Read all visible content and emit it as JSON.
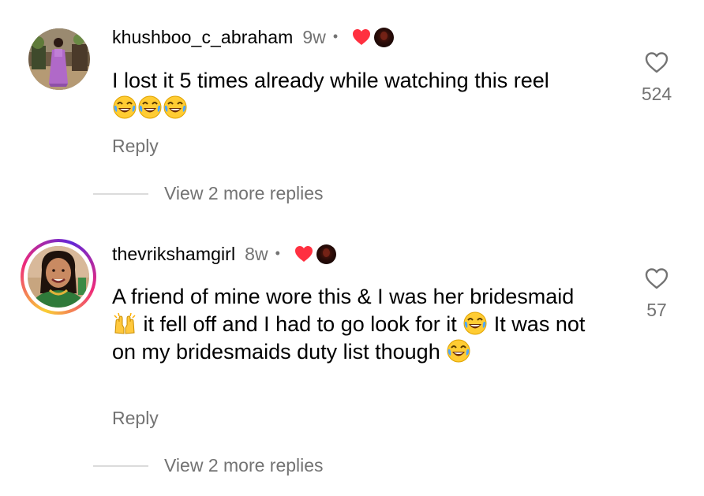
{
  "colors": {
    "text_primary": "#000000",
    "text_secondary": "#737373",
    "divider": "#dbdbdb",
    "heart_red": "#ff3040",
    "story_ring": [
      "#f9ce34",
      "#ee2a7b",
      "#6228d7"
    ]
  },
  "comments": [
    {
      "username": "khushboo_c_abraham",
      "time": "9w",
      "separator": "•",
      "creator_liked_icon": "heart-icon",
      "text_main": "I lost it 5 times already while watching this reel",
      "emojis": [
        "joy-emoji",
        "joy-emoji",
        "joy-emoji"
      ],
      "reply_label": "Reply",
      "view_replies_label": "View 2 more replies",
      "like_count": "524",
      "has_story_ring": false
    },
    {
      "username": "thevrikshamgirl",
      "time": "8w",
      "separator": "•",
      "creator_liked_icon": "heart-icon",
      "text_parts": [
        "A friend of mine wore this & I was her bridesmaid",
        "it fell off and I had to go look for it",
        "It was not on my bridesmaids duty list though"
      ],
      "emojis": [
        "raised-hands-emoji",
        "joy-emoji",
        "joy-emoji"
      ],
      "reply_label": "Reply",
      "view_replies_label": "View 2 more replies",
      "like_count": "57",
      "has_story_ring": true
    }
  ]
}
